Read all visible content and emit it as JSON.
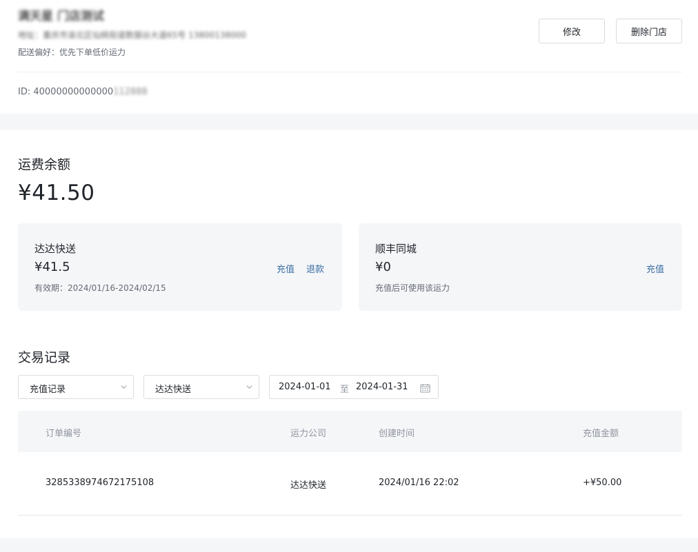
{
  "store": {
    "name": "满天星 门店测试",
    "address": "地址：重庆市渝北区仙桃街道数据谷大道65号 13800138000",
    "preference_label": "配送偏好：",
    "preference_value": "优先下单低价运力",
    "id_label": "ID: ",
    "id_visible": "40000000000000",
    "id_masked": "112888",
    "edit_label": "修改",
    "delete_label": "删除门店"
  },
  "balance": {
    "title": "运费余额",
    "amount": "¥41.50"
  },
  "carriers": [
    {
      "name": "达达快送",
      "amount": "¥41.5",
      "note_label": "有效期：",
      "note_value": "2024/01/16-2024/02/15",
      "recharge_label": "充值",
      "refund_label": "退款"
    },
    {
      "name": "顺丰同城",
      "amount": "¥0",
      "note_label": "充值后可使用该运力",
      "note_value": "",
      "recharge_label": "充值"
    }
  ],
  "transactions": {
    "title": "交易记录",
    "filters": {
      "type_selected": "充值记录",
      "carrier_selected": "达达快送",
      "date_start": "2024-01-01",
      "date_separator": "至",
      "date_end": "2024-01-31"
    },
    "columns": [
      "订单编号",
      "运力公司",
      "创建时间",
      "充值金额"
    ],
    "rows": [
      {
        "order_no": "3285338974672175108",
        "carrier": "达达快送",
        "created": "2024/01/16 22:02",
        "amount": "+¥50.00"
      }
    ]
  },
  "colors": {
    "link": "#3a6ea5",
    "panel_bg": "#f5f6f8",
    "muted_text": "#646a73"
  },
  "icons": {
    "select_chevron": "chevron-down-icon",
    "date_picker": "calendar-icon"
  }
}
